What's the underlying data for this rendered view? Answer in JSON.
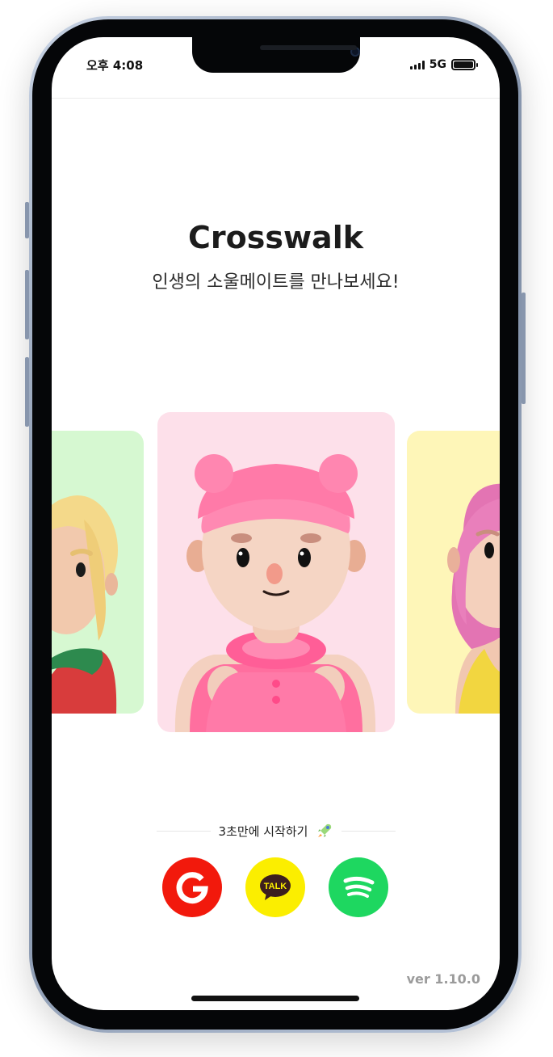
{
  "status_bar": {
    "time": "오후 4:08",
    "network": "5G",
    "signal_icon": "signal-bars-icon",
    "battery_icon": "battery-icon"
  },
  "header": {
    "title": "Crosswalk",
    "subtitle": "인생의 소울메이트를 만나보세요!"
  },
  "carousel": {
    "cards": [
      {
        "name": "avatar-blonde",
        "bg": "#d6f8d1"
      },
      {
        "name": "avatar-pink-beanie",
        "bg": "#fde0ea"
      },
      {
        "name": "avatar-pink-hair",
        "bg": "#fef6b8"
      }
    ]
  },
  "login": {
    "prompt": "3초만에 시작하기",
    "prompt_icon": "rocket-icon",
    "buttons": [
      {
        "provider": "google",
        "icon": "google-icon",
        "color": "#f2190c"
      },
      {
        "provider": "kakao",
        "icon": "kakao-talk-icon",
        "label": "TALK",
        "color": "#fbee00"
      },
      {
        "provider": "spotify",
        "icon": "spotify-icon",
        "color": "#1ed760"
      }
    ]
  },
  "footer": {
    "version": "ver 1.10.0"
  }
}
